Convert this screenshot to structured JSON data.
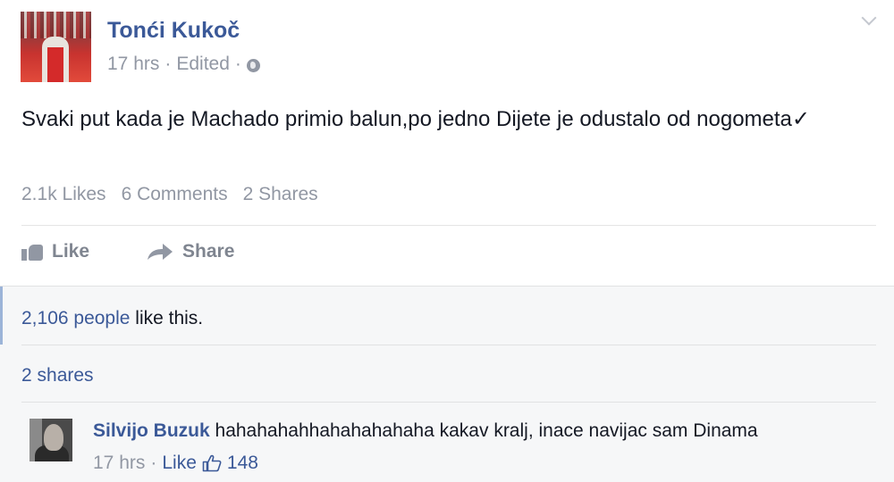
{
  "post": {
    "author": "Tonći Kukoč",
    "time": "17 hrs",
    "edited": "Edited",
    "separator": "·",
    "text": "Svaki put kada je Machado primio balun,po jedno Dijete je odustalo od nogometa✅",
    "text_display": "Svaki put kada je Machado primio balun,po jedno Dijete je odustalo od nogometa✓",
    "stats": {
      "likes": "2.1k Likes",
      "comments": "6 Comments",
      "shares": "2 Shares"
    },
    "actions": {
      "like": "Like",
      "share": "Share"
    }
  },
  "panel": {
    "likes_count": "2,106 people",
    "likes_suffix": " like this.",
    "shares": "2 shares"
  },
  "comment": {
    "author": "Silvijo Buzuk",
    "text": " hahahahahhahahahahaha kakav kralj, inace navijac sam Dinama",
    "time": "17 hrs",
    "separator": "·",
    "like": "Like",
    "like_count": "148"
  },
  "icons": {
    "privacy": "globe-icon",
    "options": "chevron-down-icon",
    "like": "thumbs-up-icon",
    "share": "share-arrow-icon"
  },
  "colors": {
    "link": "#3b5998",
    "muted": "#9197a3",
    "panel_bg": "#f6f7f8"
  }
}
